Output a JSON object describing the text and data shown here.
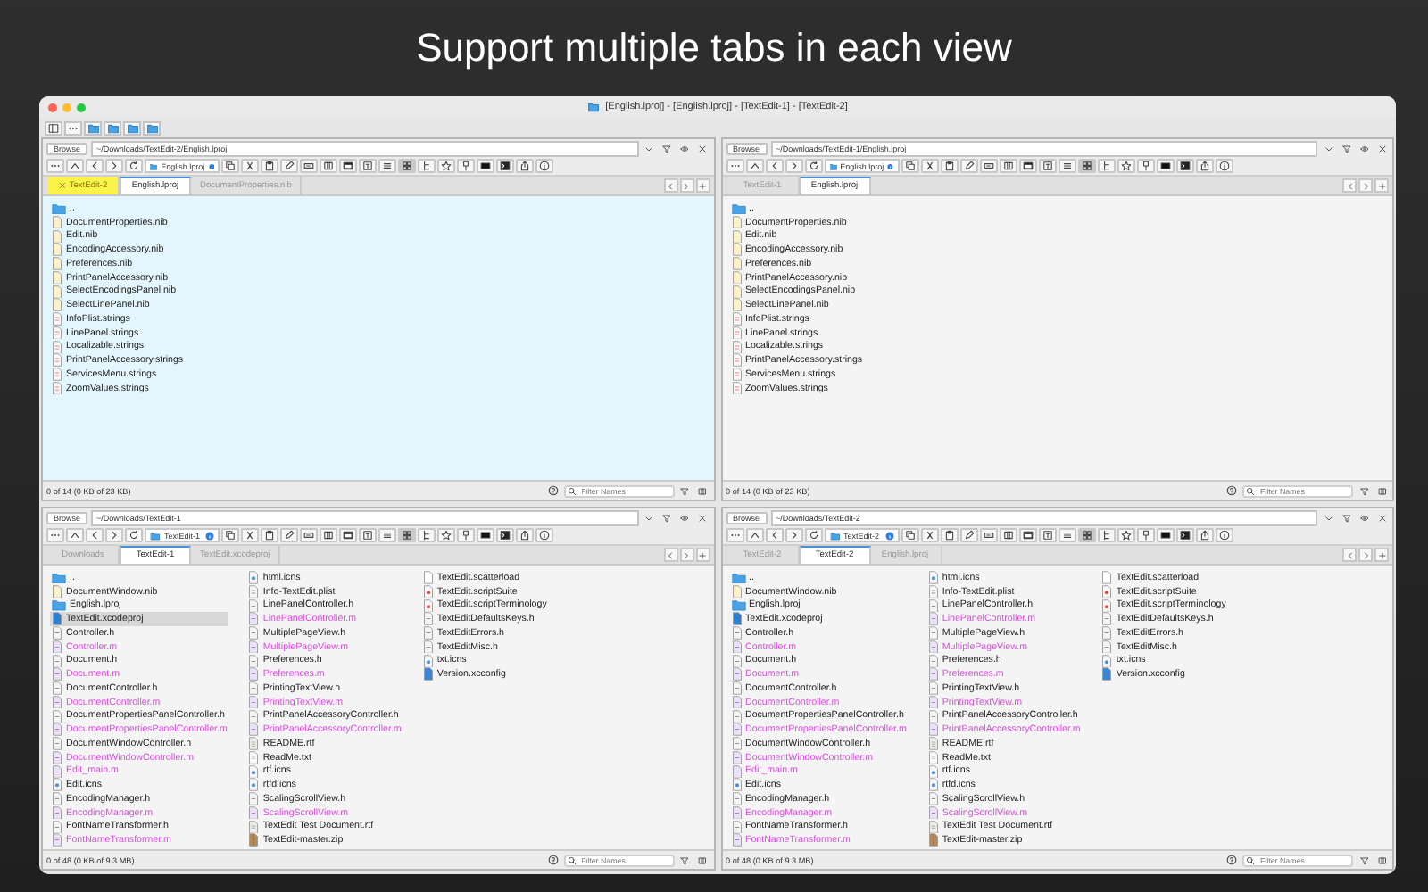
{
  "heading": "Support multiple tabs in each view",
  "window": {
    "title": "[English.lproj] - [English.lproj] - [TextEdit-1] - [TextEdit-2]"
  },
  "panes": [
    {
      "active": true,
      "browse": "Browse",
      "path": "~/Downloads/TextEdit-2/English.lproj",
      "location": "English.lproj",
      "grid_view": true,
      "tabs": [
        {
          "label": "TextEdit-2",
          "selected": false,
          "highlighted": true
        },
        {
          "label": "English.lproj",
          "selected": true,
          "highlighted": false
        },
        {
          "label": "DocumentProperties.nib",
          "selected": false,
          "highlighted": false
        }
      ],
      "files": [
        {
          "name": "..",
          "kind": "parent",
          "selected": false
        },
        {
          "name": "DocumentProperties.nib",
          "kind": "nib",
          "selected": false
        },
        {
          "name": "Edit.nib",
          "kind": "nib",
          "selected": false
        },
        {
          "name": "EncodingAccessory.nib",
          "kind": "nib",
          "selected": false
        },
        {
          "name": "Preferences.nib",
          "kind": "nib",
          "selected": false
        },
        {
          "name": "PrintPanelAccessory.nib",
          "kind": "nib",
          "selected": false
        },
        {
          "name": "SelectEncodingsPanel.nib",
          "kind": "nib",
          "selected": false
        },
        {
          "name": "SelectLinePanel.nib",
          "kind": "nib",
          "selected": false
        },
        {
          "name": "InfoPlist.strings",
          "kind": "strings",
          "selected": false
        },
        {
          "name": "LinePanel.strings",
          "kind": "strings",
          "selected": false
        },
        {
          "name": "Localizable.strings",
          "kind": "strings",
          "selected": false
        },
        {
          "name": "PrintPanelAccessory.strings",
          "kind": "strings",
          "selected": false
        },
        {
          "name": "ServicesMenu.strings",
          "kind": "strings",
          "selected": false
        },
        {
          "name": "ZoomValues.strings",
          "kind": "strings",
          "selected": false
        }
      ],
      "status": "0 of 14 (0 KB of 23 KB)",
      "filter_placeholder": "Filter Names"
    },
    {
      "active": false,
      "browse": "Browse",
      "path": "~/Downloads/TextEdit-1/English.lproj",
      "location": "English.lproj",
      "grid_view": true,
      "tabs": [
        {
          "label": "TextEdit-1",
          "selected": false,
          "highlighted": false
        },
        {
          "label": "English.lproj",
          "selected": true,
          "highlighted": false
        }
      ],
      "files": [
        {
          "name": "..",
          "kind": "parent",
          "selected": false
        },
        {
          "name": "DocumentProperties.nib",
          "kind": "nib",
          "selected": false
        },
        {
          "name": "Edit.nib",
          "kind": "nib",
          "selected": false
        },
        {
          "name": "EncodingAccessory.nib",
          "kind": "nib",
          "selected": false
        },
        {
          "name": "Preferences.nib",
          "kind": "nib",
          "selected": false
        },
        {
          "name": "PrintPanelAccessory.nib",
          "kind": "nib",
          "selected": false
        },
        {
          "name": "SelectEncodingsPanel.nib",
          "kind": "nib",
          "selected": false
        },
        {
          "name": "SelectLinePanel.nib",
          "kind": "nib",
          "selected": false
        },
        {
          "name": "InfoPlist.strings",
          "kind": "strings",
          "selected": false
        },
        {
          "name": "LinePanel.strings",
          "kind": "strings",
          "selected": false
        },
        {
          "name": "Localizable.strings",
          "kind": "strings",
          "selected": false
        },
        {
          "name": "PrintPanelAccessory.strings",
          "kind": "strings",
          "selected": false
        },
        {
          "name": "ServicesMenu.strings",
          "kind": "strings",
          "selected": false
        },
        {
          "name": "ZoomValues.strings",
          "kind": "strings",
          "selected": false
        }
      ],
      "status": "0 of 14 (0 KB of 23 KB)",
      "filter_placeholder": "Filter Names"
    },
    {
      "active": false,
      "browse": "Browse",
      "path": "~/Downloads/TextEdit-1",
      "location": "TextEdit-1",
      "grid_view": true,
      "tabs": [
        {
          "label": "Downloads",
          "selected": false,
          "highlighted": false
        },
        {
          "label": "TextEdit-1",
          "selected": true,
          "highlighted": false
        },
        {
          "label": "TextEdit.xcodeproj",
          "selected": false,
          "highlighted": false
        }
      ],
      "files": [
        {
          "name": "..",
          "kind": "parent",
          "selected": false
        },
        {
          "name": "DocumentWindow.nib",
          "kind": "nib",
          "selected": false
        },
        {
          "name": "English.lproj",
          "kind": "folder",
          "selected": false
        },
        {
          "name": "TextEdit.xcodeproj",
          "kind": "project",
          "selected": true
        },
        {
          "name": "Controller.h",
          "kind": "h",
          "selected": false
        },
        {
          "name": "Controller.m",
          "kind": "m",
          "selected": false
        },
        {
          "name": "Document.h",
          "kind": "h",
          "selected": false
        },
        {
          "name": "Document.m",
          "kind": "m",
          "selected": false
        },
        {
          "name": "DocumentController.h",
          "kind": "h",
          "selected": false
        },
        {
          "name": "DocumentController.m",
          "kind": "m",
          "selected": false
        },
        {
          "name": "DocumentPropertiesPanelController.h",
          "kind": "h",
          "selected": false
        },
        {
          "name": "DocumentPropertiesPanelController.m",
          "kind": "m",
          "selected": false
        },
        {
          "name": "DocumentWindowController.h",
          "kind": "h",
          "selected": false
        },
        {
          "name": "DocumentWindowController.m",
          "kind": "m",
          "selected": false
        },
        {
          "name": "Edit_main.m",
          "kind": "m",
          "selected": false
        },
        {
          "name": "Edit.icns",
          "kind": "icns",
          "selected": false
        },
        {
          "name": "EncodingManager.h",
          "kind": "h",
          "selected": false
        },
        {
          "name": "EncodingManager.m",
          "kind": "m",
          "selected": false
        },
        {
          "name": "FontNameTransformer.h",
          "kind": "h",
          "selected": false
        },
        {
          "name": "FontNameTransformer.m",
          "kind": "m",
          "selected": false
        },
        {
          "name": "html.icns",
          "kind": "icns",
          "selected": false
        },
        {
          "name": "Info-TextEdit.plist",
          "kind": "plist",
          "selected": false
        },
        {
          "name": "LinePanelController.h",
          "kind": "h",
          "selected": false
        },
        {
          "name": "LinePanelController.m",
          "kind": "m",
          "selected": false
        },
        {
          "name": "MultiplePageView.h",
          "kind": "h",
          "selected": false
        },
        {
          "name": "MultiplePageView.m",
          "kind": "m",
          "selected": false
        },
        {
          "name": "Preferences.h",
          "kind": "h",
          "selected": false
        },
        {
          "name": "Preferences.m",
          "kind": "m",
          "selected": false
        },
        {
          "name": "PrintingTextView.h",
          "kind": "h",
          "selected": false
        },
        {
          "name": "PrintingTextView.m",
          "kind": "m",
          "selected": false
        },
        {
          "name": "PrintPanelAccessoryController.h",
          "kind": "h",
          "selected": false
        },
        {
          "name": "PrintPanelAccessoryController.m",
          "kind": "m",
          "selected": false
        },
        {
          "name": "README.rtf",
          "kind": "rtf",
          "selected": false
        },
        {
          "name": "ReadMe.txt",
          "kind": "txt",
          "selected": false
        },
        {
          "name": "rtf.icns",
          "kind": "icns",
          "selected": false
        },
        {
          "name": "rtfd.icns",
          "kind": "icns",
          "selected": false
        },
        {
          "name": "ScalingScrollView.h",
          "kind": "h",
          "selected": false
        },
        {
          "name": "ScalingScrollView.m",
          "kind": "m",
          "selected": false
        },
        {
          "name": "TextEdit Test Document.rtf",
          "kind": "rtf",
          "selected": false
        },
        {
          "name": "TextEdit-master.zip",
          "kind": "zip",
          "selected": false
        },
        {
          "name": "TextEdit.scatterload",
          "kind": "blank",
          "selected": false
        },
        {
          "name": "TextEdit.scriptSuite",
          "kind": "script",
          "selected": false
        },
        {
          "name": "TextEdit.scriptTerminology",
          "kind": "script",
          "selected": false
        },
        {
          "name": "TextEditDefaultsKeys.h",
          "kind": "h",
          "selected": false
        },
        {
          "name": "TextEditErrors.h",
          "kind": "h",
          "selected": false
        },
        {
          "name": "TextEditMisc.h",
          "kind": "h",
          "selected": false
        },
        {
          "name": "txt.icns",
          "kind": "icns",
          "selected": false
        },
        {
          "name": "Version.xcconfig",
          "kind": "xcconfig",
          "selected": false
        }
      ],
      "status": "0 of 48 (0 KB of 9.3 MB)",
      "filter_placeholder": "Filter Names"
    },
    {
      "active": false,
      "browse": "Browse",
      "path": "~/Downloads/TextEdit-2",
      "location": "TextEdit-2",
      "grid_view": true,
      "tabs": [
        {
          "label": "TextEdit-2",
          "selected": false,
          "highlighted": false
        },
        {
          "label": "TextEdit-2",
          "selected": true,
          "highlighted": false
        },
        {
          "label": "English.lproj",
          "selected": false,
          "highlighted": false
        }
      ],
      "files": [
        {
          "name": "..",
          "kind": "parent",
          "selected": false
        },
        {
          "name": "DocumentWindow.nib",
          "kind": "nib",
          "selected": false
        },
        {
          "name": "English.lproj",
          "kind": "folder",
          "selected": false
        },
        {
          "name": "TextEdit.xcodeproj",
          "kind": "project",
          "selected": false
        },
        {
          "name": "Controller.h",
          "kind": "h",
          "selected": false
        },
        {
          "name": "Controller.m",
          "kind": "m",
          "selected": false
        },
        {
          "name": "Document.h",
          "kind": "h",
          "selected": false
        },
        {
          "name": "Document.m",
          "kind": "m",
          "selected": false
        },
        {
          "name": "DocumentController.h",
          "kind": "h",
          "selected": false
        },
        {
          "name": "DocumentController.m",
          "kind": "m",
          "selected": false
        },
        {
          "name": "DocumentPropertiesPanelController.h",
          "kind": "h",
          "selected": false
        },
        {
          "name": "DocumentPropertiesPanelController.m",
          "kind": "m",
          "selected": false
        },
        {
          "name": "DocumentWindowController.h",
          "kind": "h",
          "selected": false
        },
        {
          "name": "DocumentWindowController.m",
          "kind": "m",
          "selected": false
        },
        {
          "name": "Edit_main.m",
          "kind": "m",
          "selected": false
        },
        {
          "name": "Edit.icns",
          "kind": "icns",
          "selected": false
        },
        {
          "name": "EncodingManager.h",
          "kind": "h",
          "selected": false
        },
        {
          "name": "EncodingManager.m",
          "kind": "m",
          "selected": false
        },
        {
          "name": "FontNameTransformer.h",
          "kind": "h",
          "selected": false
        },
        {
          "name": "FontNameTransformer.m",
          "kind": "m",
          "selected": false
        },
        {
          "name": "html.icns",
          "kind": "icns",
          "selected": false
        },
        {
          "name": "Info-TextEdit.plist",
          "kind": "plist",
          "selected": false
        },
        {
          "name": "LinePanelController.h",
          "kind": "h",
          "selected": false
        },
        {
          "name": "LinePanelController.m",
          "kind": "m",
          "selected": false
        },
        {
          "name": "MultiplePageView.h",
          "kind": "h",
          "selected": false
        },
        {
          "name": "MultiplePageView.m",
          "kind": "m",
          "selected": false
        },
        {
          "name": "Preferences.h",
          "kind": "h",
          "selected": false
        },
        {
          "name": "Preferences.m",
          "kind": "m",
          "selected": false
        },
        {
          "name": "PrintingTextView.h",
          "kind": "h",
          "selected": false
        },
        {
          "name": "PrintingTextView.m",
          "kind": "m",
          "selected": false
        },
        {
          "name": "PrintPanelAccessoryController.h",
          "kind": "h",
          "selected": false
        },
        {
          "name": "PrintPanelAccessoryController.m",
          "kind": "m",
          "selected": false
        },
        {
          "name": "README.rtf",
          "kind": "rtf",
          "selected": false
        },
        {
          "name": "ReadMe.txt",
          "kind": "txt",
          "selected": false
        },
        {
          "name": "rtf.icns",
          "kind": "icns",
          "selected": false
        },
        {
          "name": "rtfd.icns",
          "kind": "icns",
          "selected": false
        },
        {
          "name": "ScalingScrollView.h",
          "kind": "h",
          "selected": false
        },
        {
          "name": "ScalingScrollView.m",
          "kind": "m",
          "selected": false
        },
        {
          "name": "TextEdit Test Document.rtf",
          "kind": "rtf",
          "selected": false
        },
        {
          "name": "TextEdit-master.zip",
          "kind": "zip",
          "selected": false
        },
        {
          "name": "TextEdit.scatterload",
          "kind": "blank",
          "selected": false
        },
        {
          "name": "TextEdit.scriptSuite",
          "kind": "script",
          "selected": false
        },
        {
          "name": "TextEdit.scriptTerminology",
          "kind": "script",
          "selected": false
        },
        {
          "name": "TextEditDefaultsKeys.h",
          "kind": "h",
          "selected": false
        },
        {
          "name": "TextEditErrors.h",
          "kind": "h",
          "selected": false
        },
        {
          "name": "TextEditMisc.h",
          "kind": "h",
          "selected": false
        },
        {
          "name": "txt.icns",
          "kind": "icns",
          "selected": false
        },
        {
          "name": "Version.xcconfig",
          "kind": "xcconfig",
          "selected": false
        }
      ],
      "status": "0 of 48 (0 KB of 9.3 MB)",
      "filter_placeholder": "Filter Names"
    }
  ]
}
